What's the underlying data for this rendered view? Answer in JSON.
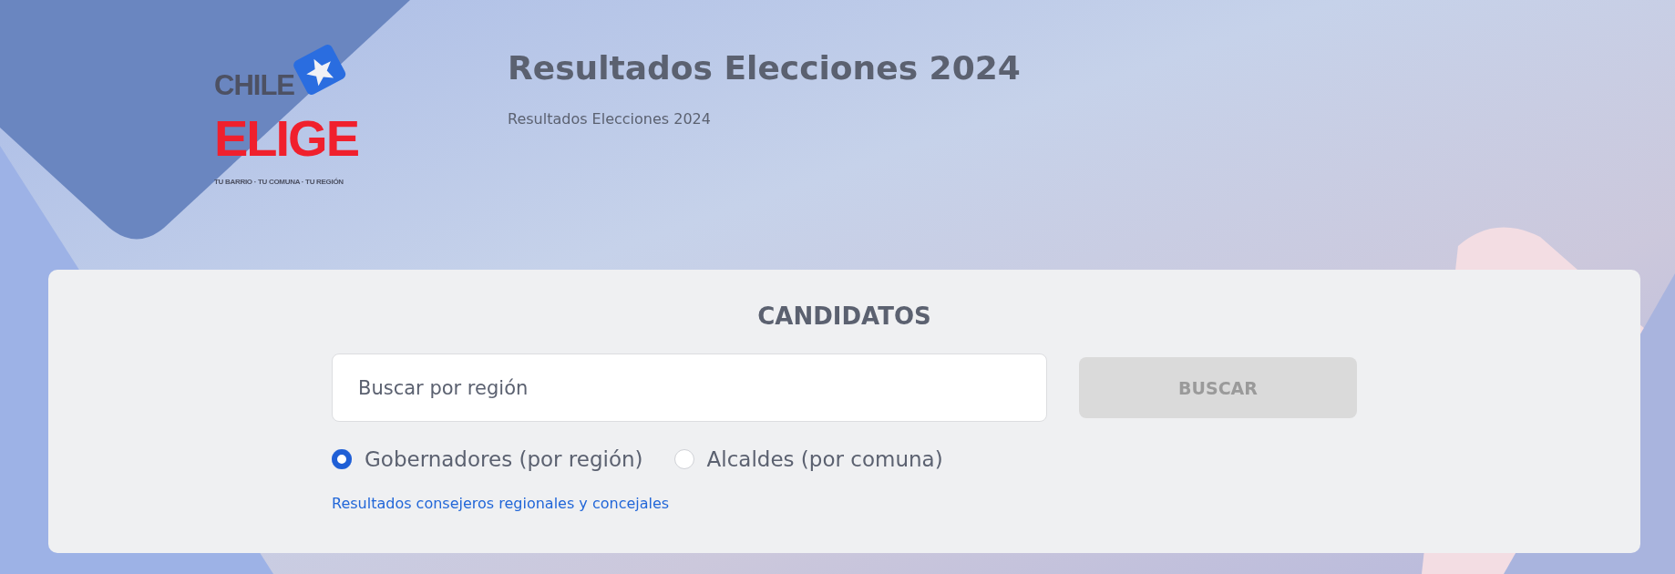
{
  "logo": {
    "top": "CHILE",
    "main": "ELIGE",
    "tagline": "TU BARRIO · TU COMUNA · TU REGIÓN"
  },
  "header": {
    "title": "Resultados Elecciones 2024",
    "subtitle": "Resultados Elecciones 2024"
  },
  "panel": {
    "heading": "CANDIDATOS",
    "search": {
      "placeholder": "Buscar por región"
    },
    "button": {
      "label": "BUSCAR",
      "disabled": true
    },
    "options": [
      {
        "label": "Gobernadores (por región)",
        "selected": true
      },
      {
        "label": "Alcaldes (por comuna)",
        "selected": false
      }
    ],
    "link": "Resultados consejeros regionales y concejales"
  }
}
